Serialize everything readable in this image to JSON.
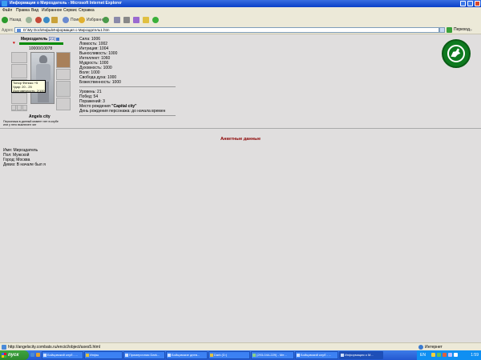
{
  "window": {
    "title": "Информация о Мироздатель - Microsoft Internet Explorer"
  },
  "menu": [
    "Файл",
    "Правка",
    "Вид",
    "Избранное",
    "Сервис",
    "Справка"
  ],
  "toolbar": {
    "back": "Назад",
    "search": "Поиск",
    "favorites": "Избранное"
  },
  "address": {
    "label": "Адрес",
    "value": "D:\\My Doc\\Инфы\\Информация о Мироздатель1.htm",
    "go": "Переход",
    "links": "»"
  },
  "character": {
    "name": "Мироздатель",
    "level": "[21]",
    "hp": "10000/10078",
    "city": "Angels city",
    "club_note": "Персонажа в данный момент нет в клубе или у него выключен чат"
  },
  "tooltip": [
    "Топор Феникс +5",
    "Удар: 20 - 25",
    "Долговечность: 2/100"
  ],
  "stats": [
    "Сила: 1006",
    "Ловкость: 1002",
    "Интуиция: 1004",
    "Выносливость: 1000",
    "Интеллект: 1060",
    "Мудрость: 1000",
    "Духовность: 1000",
    "Воля: 1000",
    "Свобода духа: 1000",
    "Божественность: 1000"
  ],
  "stats2": [
    "Уровень: 21",
    "Побед: 54",
    "Поражений: 3"
  ],
  "birthplace": {
    "label": "Место рождения ",
    "value": "\"Capital city\""
  },
  "birthday": "День рождения персонажа: до начала времен",
  "section_title": "Анкетные данные",
  "profile": [
    "Имя: Мироздатель",
    "Пол: Мужской",
    "Город: Москва",
    "Девиз: В начале был я"
  ],
  "status": {
    "url": "http://angelscity.combats.ru/encicl/object/axes5.html",
    "zone": "Интернет"
  },
  "taskbar": {
    "start": "пуск",
    "tasks": [
      "Бойцовский клуб - ...",
      "Инфы",
      "Примерочная Dark...",
      "Бойцовские днев...",
      "Dark (D:)",
      "(293-044-229) - Ме...",
      "Бойцовский клуб - ...",
      "Информация о М..."
    ],
    "tray_lang": "EN",
    "clock": "1:59"
  },
  "colors": {
    "accent": "#0a3fc8",
    "hp": "#008a00",
    "section": "#8b0000",
    "logo": "#0e7a1f"
  }
}
